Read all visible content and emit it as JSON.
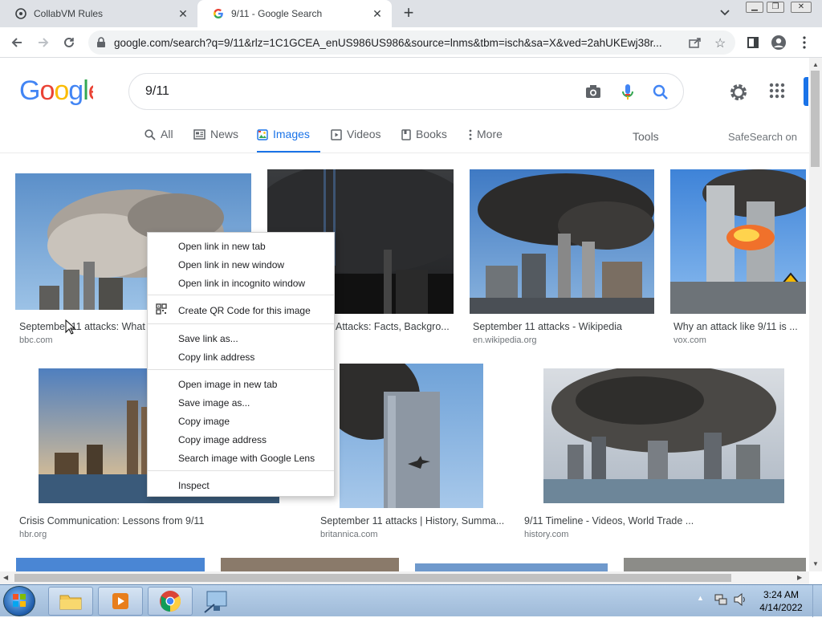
{
  "browser": {
    "tabs": [
      {
        "title": "CollabVM Rules",
        "favicon": "collabvm-icon"
      },
      {
        "title": "9/11 - Google Search",
        "favicon": "google-icon"
      }
    ],
    "url": "google.com/search?q=9/11&rlz=1C1GCEA_enUS986US986&source=lnms&tbm=isch&sa=X&ved=2ahUKEwj38r..."
  },
  "google": {
    "logo": "Google",
    "query": "9/11",
    "nav": {
      "all": "All",
      "news": "News",
      "images": "Images",
      "videos": "Videos",
      "books": "Books",
      "more": "More",
      "tools": "Tools",
      "safesearch": "SafeSearch on"
    }
  },
  "results": [
    {
      "title": "September 11 attacks: What",
      "source": "bbc.com"
    },
    {
      "title": "Attacks: Facts, Backgro...",
      "source": ""
    },
    {
      "title": "September 11 attacks - Wikipedia",
      "source": "en.wikipedia.org"
    },
    {
      "title": "Why an attack like 9/11 is ...",
      "source": "vox.com"
    },
    {
      "title": "Crisis Communication: Lessons from 9/11",
      "source": "hbr.org"
    },
    {
      "title": "September 11 attacks | History, Summa...",
      "source": "britannica.com"
    },
    {
      "title": "9/11 Timeline - Videos, World Trade ...",
      "source": "history.com"
    }
  ],
  "context_menu": {
    "items": [
      "Open link in new tab",
      "Open link in new window",
      "Open link in incognito window",
      "Create QR Code for this image",
      "Save link as...",
      "Copy link address",
      "Open image in new tab",
      "Save image as...",
      "Copy image",
      "Copy image address",
      "Search image with Google Lens",
      "Inspect"
    ]
  },
  "taskbar": {
    "time": "3:24 AM",
    "date": "4/14/2022"
  },
  "colors": {
    "accent": "#1a73e8",
    "google_blue": "#4285f4",
    "google_red": "#ea4335",
    "google_yellow": "#fbbc05",
    "google_green": "#34a853"
  }
}
